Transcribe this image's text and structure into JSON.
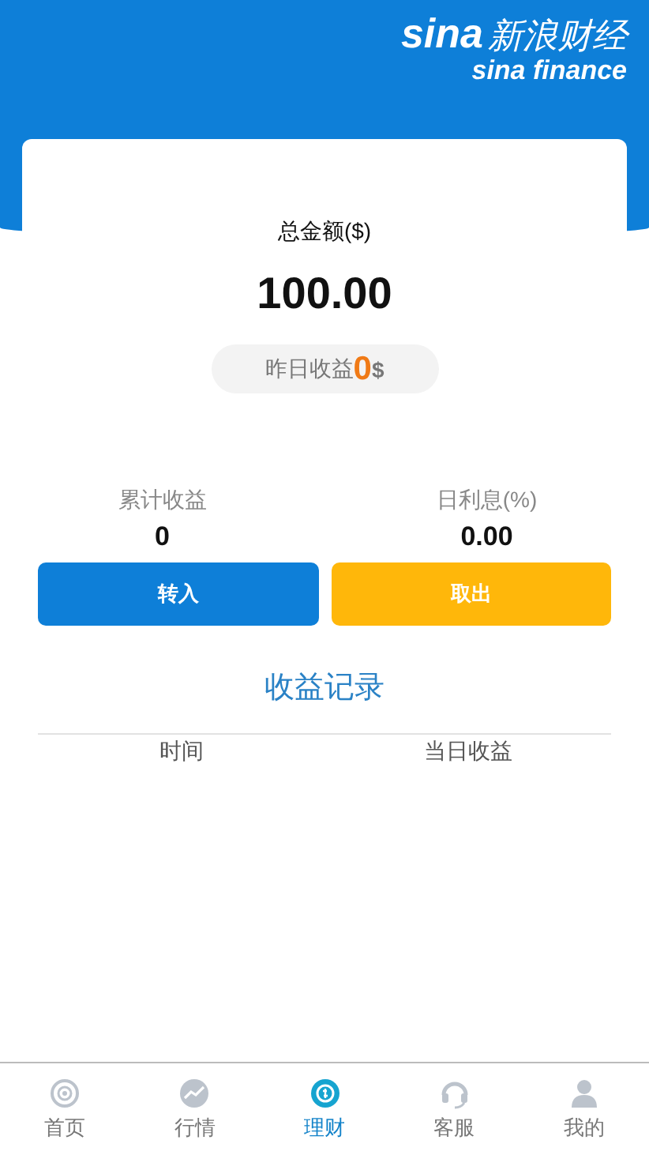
{
  "logo": {
    "mark": "sina",
    "name": "新浪财经",
    "subtitle": "sina finance"
  },
  "summary": {
    "label": "总金额($)",
    "amount": "100.00",
    "yesterday_label": "昨日收益",
    "yesterday_value": "0",
    "yesterday_unit": "$"
  },
  "stats": [
    {
      "label": "累计收益",
      "value": "0"
    },
    {
      "label": "日利息(%)",
      "value": "0.00"
    }
  ],
  "buttons": [
    {
      "label": "转入",
      "kind": "primary"
    },
    {
      "label": "取出",
      "kind": "warning"
    }
  ],
  "records": {
    "title": "收益记录",
    "columns": [
      "时间",
      "当日收益"
    ]
  },
  "nav": [
    {
      "label": "首页",
      "kind": "target",
      "selected": false
    },
    {
      "label": "行情",
      "kind": "chart",
      "selected": false
    },
    {
      "label": "理财",
      "kind": "money",
      "selected": true
    },
    {
      "label": "客服",
      "kind": "headset",
      "selected": false
    },
    {
      "label": "我的",
      "kind": "person",
      "selected": false
    }
  ]
}
